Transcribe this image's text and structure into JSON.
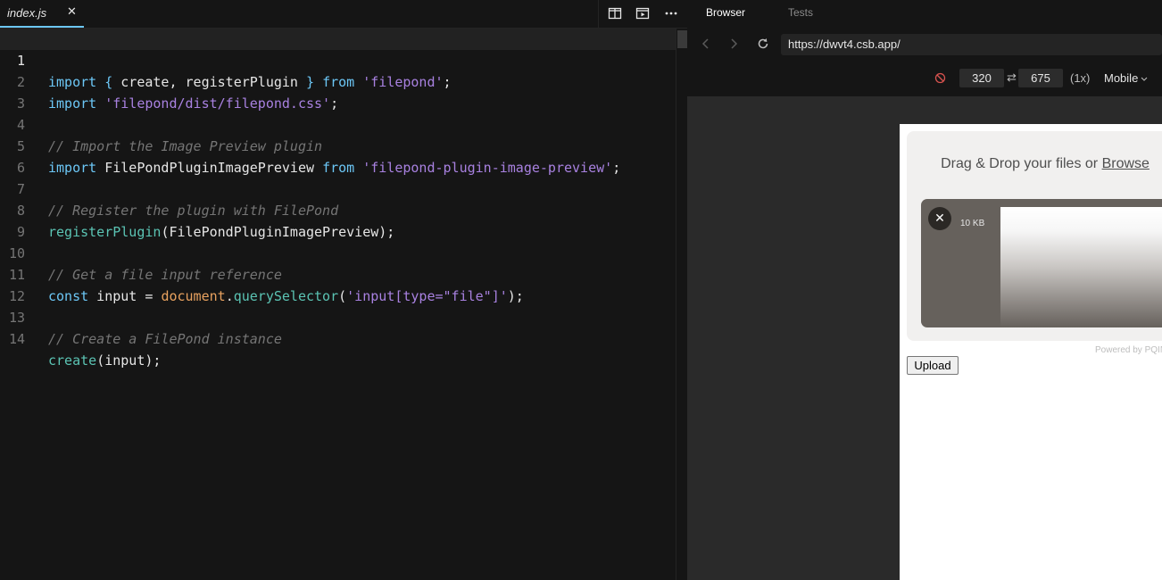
{
  "editor": {
    "tab": {
      "label": "index.js",
      "close": "✕"
    },
    "lines": [
      {
        "n": "1"
      },
      {
        "n": "2"
      },
      {
        "n": "3"
      },
      {
        "n": "4"
      },
      {
        "n": "5"
      },
      {
        "n": "6"
      },
      {
        "n": "7"
      },
      {
        "n": "8"
      },
      {
        "n": "9"
      },
      {
        "n": "10"
      },
      {
        "n": "11"
      },
      {
        "n": "12"
      },
      {
        "n": "13"
      },
      {
        "n": "14"
      }
    ],
    "code": {
      "l1": {
        "a": "import",
        "b": " { ",
        "c": "create, registerPlugin",
        "d": " } ",
        "e": "from",
        "f": " ",
        "g": "'filepond'",
        "h": ";"
      },
      "l2": {
        "a": "import",
        "b": " ",
        "c": "'filepond/dist/filepond.css'",
        "d": ";"
      },
      "l4": "// Import the Image Preview plugin",
      "l5": {
        "a": "import",
        "b": " FilePondPluginImagePreview ",
        "c": "from",
        "d": " ",
        "e": "'filepond-plugin-image-preview'",
        "f": ";"
      },
      "l7": "// Register the plugin with FilePond",
      "l8": {
        "a": "registerPlugin",
        "b": "(FilePondPluginImagePreview);"
      },
      "l10": "// Get a file input reference",
      "l11": {
        "a": "const",
        "b": " input = ",
        "c": "document",
        "d": ".",
        "e": "querySelector",
        "f": "(",
        "g": "'input[type=\"file\"]'",
        "h": ");"
      },
      "l13": "// Create a FilePond instance",
      "l14": {
        "a": "create",
        "b": "(input);"
      }
    }
  },
  "preview": {
    "tabs": {
      "browser": "Browser",
      "tests": "Tests"
    },
    "url": "https://dwvt4.csb.app/",
    "device": {
      "width": "320",
      "swap": "⇄",
      "height": "675",
      "scale": "(1x)",
      "mode": "Mobile"
    },
    "filepond": {
      "drop_prefix": "Drag & Drop your files or ",
      "browse": "Browse",
      "file_size": "10 KB",
      "remove": "✕",
      "powered": "Powered by PQINA"
    },
    "upload_button": "Upload"
  }
}
